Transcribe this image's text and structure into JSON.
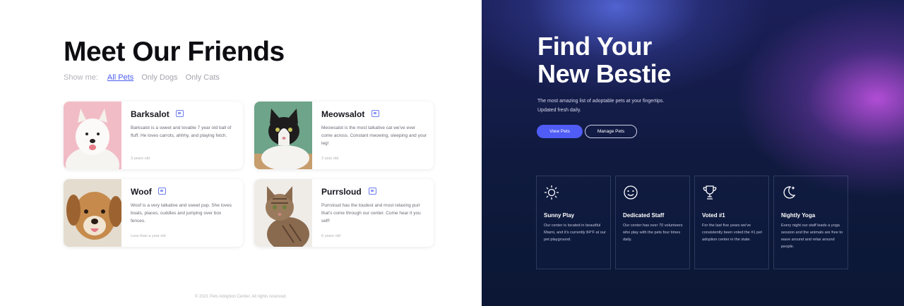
{
  "left": {
    "title": "Meet Our Friends",
    "filters": {
      "label": "Show me:",
      "items": [
        "All Pets",
        "Only Dogs",
        "Only Cats"
      ],
      "active": "All Pets"
    },
    "cards": [
      {
        "name": "Barksalot",
        "desc": "Barksalot is a sweet and lovable 7 year old ball of fluff. He loves carrots, ahhhy, and playing fetch.",
        "age": "3 years old",
        "photo": "white-fluffy-dog"
      },
      {
        "name": "Meowsalot",
        "desc": "Meowsalot is the most talkative cat we've ever come across. Constant meowing, sleeping and your leg!",
        "age": "2 year old",
        "photo": "tuxedo-cat"
      },
      {
        "name": "Woof",
        "desc": "Woof is a very talkative and sweet pup. She loves boats, places, cuddles and jumping over box fences.",
        "age": "Less than a year old",
        "photo": "golden-puppy"
      },
      {
        "name": "Purrsloud",
        "desc": "Purrsloud has the loudest and most relaxing purr that's come through our center. Come hear it you self!",
        "age": "6 years old",
        "photo": "tabby-cat"
      }
    ],
    "footer": "© 2021 Pets Adoption Center. All rights reserved."
  },
  "right": {
    "hero_title_line1": "Find Your",
    "hero_title_line2": "New Bestie",
    "hero_subtitle": "The most amazing list of adoptable pets at your fingertips. Updated fresh daily.",
    "primary_button": "View Pets",
    "secondary_button": "Manage Pets",
    "features": [
      {
        "icon": "sun-icon",
        "title": "Sunny Play",
        "desc": "Our center is located in beautiful Miami, and it's currently 84°F at our pet playground."
      },
      {
        "icon": "smiley-icon",
        "title": "Dedicated Staff",
        "desc": "Our center has over 70 volunteers who play with the pets four times daily."
      },
      {
        "icon": "trophy-icon",
        "title": "Voted #1",
        "desc": "For the last five years we've consistently been voted the #1 pet adoption center in the state."
      },
      {
        "icon": "moon-icon",
        "title": "Nightly Yoga",
        "desc": "Every night our staff leads a yoga session and the animals are free to wave around and relax around people."
      }
    ]
  },
  "colors": {
    "accent": "#4f5cf5",
    "link": "#4a5cf0",
    "dark_bg": "#0f1a3e",
    "glow_purple": "#b950dc"
  }
}
